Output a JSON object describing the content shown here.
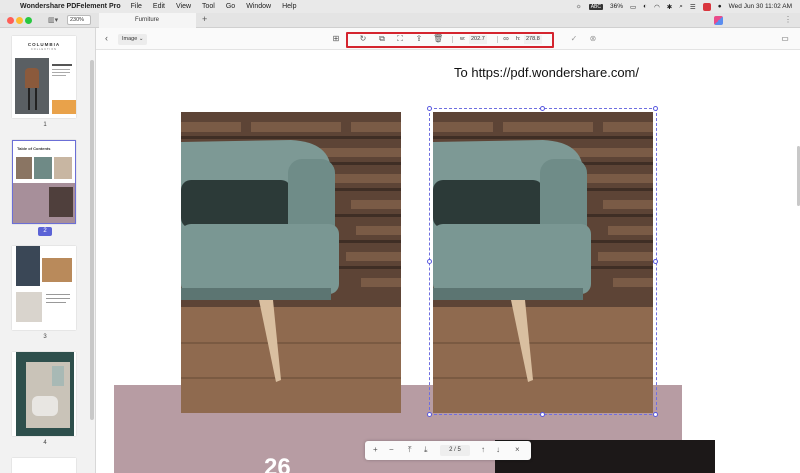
{
  "menubar": {
    "app_name": "Wondershare PDFelement Pro",
    "menus": [
      "File",
      "Edit",
      "View",
      "Tool",
      "Go",
      "Window",
      "Help"
    ],
    "input_source": "ABC",
    "battery": "36%",
    "datetime": "Wed Jun 30  11:02 AM"
  },
  "window": {
    "zoom": "230%",
    "tab_title": "Furniture",
    "new_tab": "+"
  },
  "thumbnails": {
    "pages": [
      {
        "number": "1",
        "heading": "COLUMBIA",
        "subheading": "COLLECTION"
      },
      {
        "number": "2",
        "heading": "Table of Contents"
      },
      {
        "number": "3"
      },
      {
        "number": "4"
      }
    ],
    "selected_page": 2
  },
  "toolbar": {
    "back_label": "‹",
    "mode_label": "Image ⌄",
    "width_label": "w:",
    "width_value": "202.7",
    "height_label": "h:",
    "height_value": "278.8",
    "confirm_icon": "checkmark",
    "cancel_icon": "cancel-circle"
  },
  "page_content": {
    "url_text": "To https://pdf.wondershare.com/",
    "big_number": "26"
  },
  "navigation": {
    "current_page": "2",
    "separator": "/",
    "total_pages": "5"
  },
  "colors": {
    "accent": "#5b63d6",
    "highlight": "#d4242e",
    "mauve": "#b79ca3",
    "chair_fabric": "#7a9793",
    "wood_floor": "#8f6a4f"
  }
}
